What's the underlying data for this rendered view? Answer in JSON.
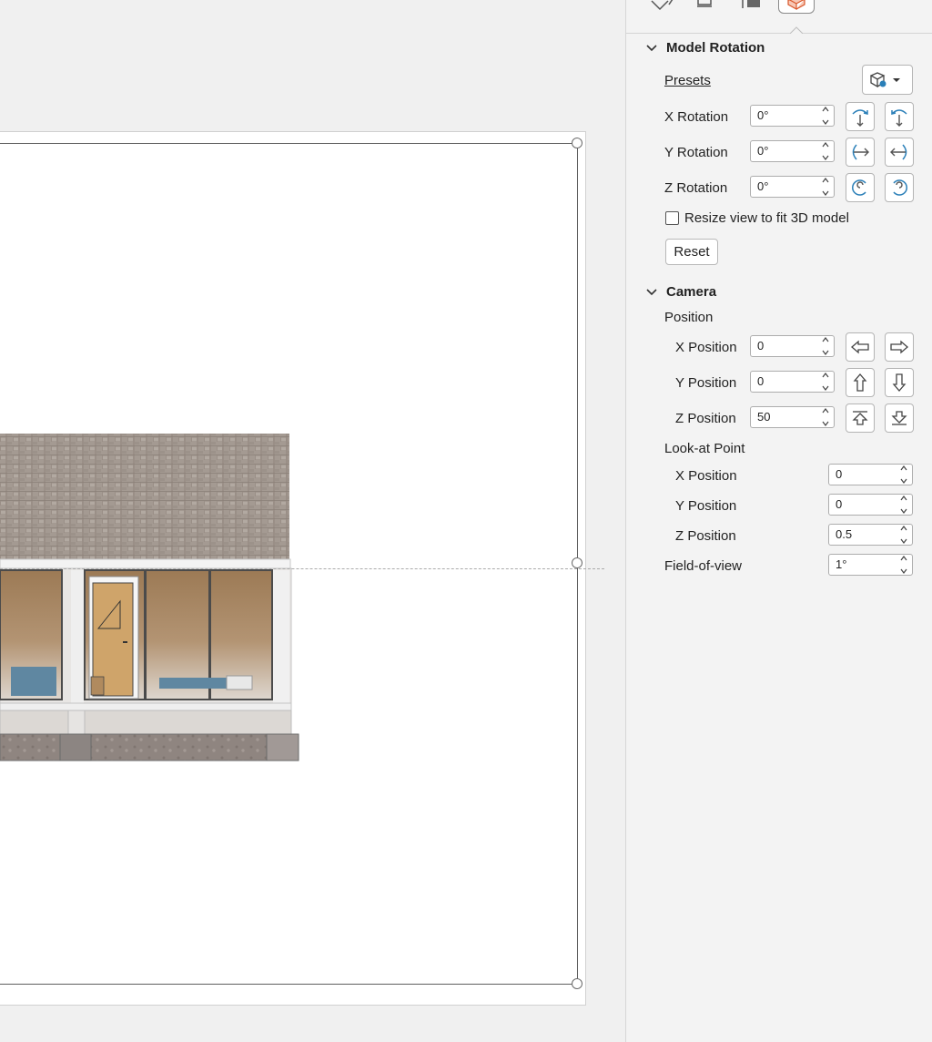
{
  "model_rotation": {
    "title": "Model Rotation",
    "presets_label": "Presets",
    "x_rotation": {
      "label": "X Rotation",
      "value": "0°"
    },
    "y_rotation": {
      "label": "Y Rotation",
      "value": "0°"
    },
    "z_rotation": {
      "label": "Z Rotation",
      "value": "0°"
    },
    "resize_label": "Resize view to fit 3D model",
    "resize_checked": false,
    "reset_label": "Reset"
  },
  "camera": {
    "title": "Camera",
    "position_label": "Position",
    "x_position": {
      "label": "X Position",
      "value": "0"
    },
    "y_position": {
      "label": "Y Position",
      "value": "0"
    },
    "z_position": {
      "label": "Z Position",
      "value": "50"
    },
    "look_at_label": "Look-at Point",
    "look_x": {
      "label": "X Position",
      "value": "0"
    },
    "look_y": {
      "label": "Y Position",
      "value": "0"
    },
    "look_z": {
      "label": "Z Position",
      "value": "0.5"
    },
    "fov": {
      "label": "Field-of-view",
      "value": "1°"
    }
  },
  "colors": {
    "icon_blue": "#2a7fb8",
    "accent_orange": "#d9572b",
    "pane_bg": "#f3f3f3"
  },
  "tabs": [
    "fill-line-icon",
    "effects-icon",
    "size-properties-icon",
    "3d-model-icon"
  ]
}
